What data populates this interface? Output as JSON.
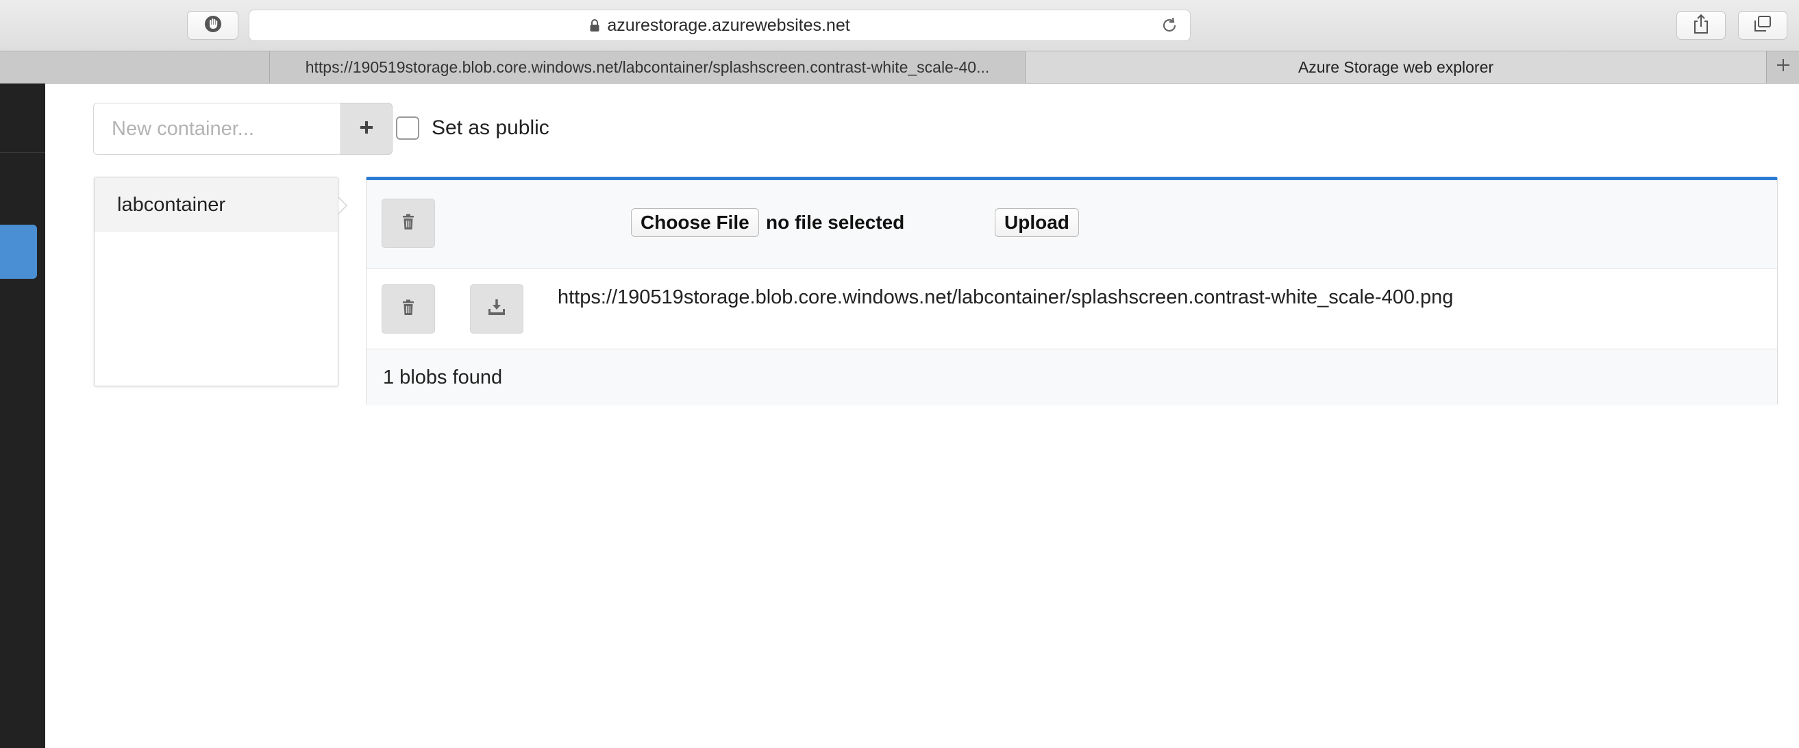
{
  "browser": {
    "address": "azurestorage.azurewebsites.net",
    "icons": {
      "privacy": "hand-stop-icon",
      "lock": "lock-icon",
      "reload": "reload-icon",
      "share": "share-icon",
      "tabs": "tabs-overview-icon",
      "new_tab": "plus-icon"
    },
    "tabs": [
      {
        "label": "https://190519storage.blob.core.windows.net/labcontainer/splashscreen.contrast-white_scale-40...",
        "active": false
      },
      {
        "label": "Azure Storage web explorer",
        "active": true
      }
    ],
    "new_tab_label": "+"
  },
  "sidebar": {
    "bg_color": "#222222",
    "active_color": "#4a8fd4"
  },
  "new_container": {
    "placeholder": "New container...",
    "value": "",
    "add_icon": "plus-icon",
    "public_checked": false,
    "public_label": "Set as public"
  },
  "containers": {
    "items": [
      {
        "name": "labcontainer",
        "selected": true
      }
    ]
  },
  "blobs": {
    "accent_color": "#2b7bd5",
    "choose_file_label": "Choose File",
    "no_file_label": "no file selected",
    "upload_label": "Upload",
    "delete_icon": "trash-icon",
    "download_icon": "download-icon",
    "items": [
      {
        "url": "https://190519storage.blob.core.windows.net/labcontainer/splashscreen.contrast-white_scale-400.png"
      }
    ],
    "count_text": "1 blobs found"
  }
}
